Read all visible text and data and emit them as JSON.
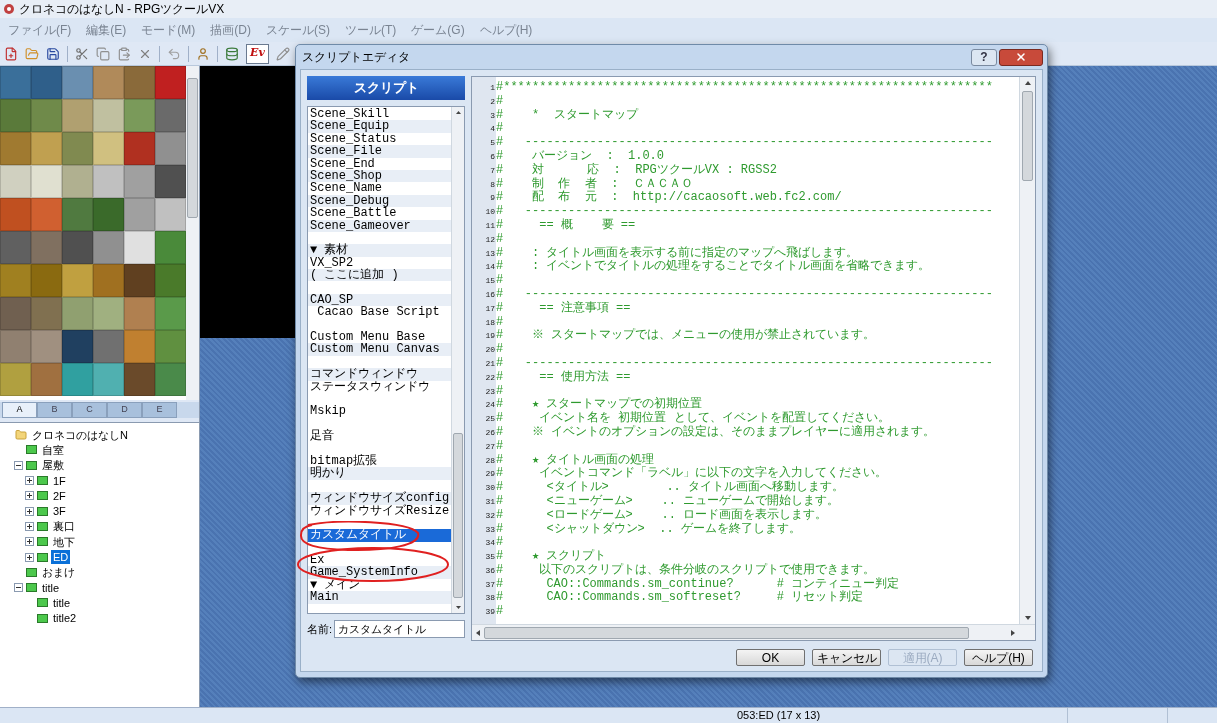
{
  "window": {
    "title": "クロネコのはなしN - RPGツクールVX"
  },
  "menu": [
    "ファイル(F)",
    "編集(E)",
    "モード(M)",
    "描画(D)",
    "スケール(S)",
    "ツール(T)",
    "ゲーム(G)",
    "ヘルプ(H)"
  ],
  "toolbar": {
    "event_button": {
      "label": "Ev",
      "selected": true
    }
  },
  "tileset_tabs": [
    {
      "label": "A",
      "selected": true
    },
    {
      "label": "B",
      "selected": false
    },
    {
      "label": "C",
      "selected": false
    },
    {
      "label": "D",
      "selected": false
    },
    {
      "label": "E",
      "selected": false
    }
  ],
  "map_tree": [
    {
      "kind": "project",
      "label": "クロネコのはなしN",
      "selected": false,
      "children": [
        {
          "kind": "map",
          "label": "自室",
          "selected": false
        },
        {
          "kind": "map",
          "label": "屋敷",
          "selected": false,
          "expanded": true,
          "children": [
            {
              "kind": "map",
              "label": "1F",
              "selected": false,
              "expanded": false
            },
            {
              "kind": "map",
              "label": "2F",
              "selected": false,
              "expanded": false
            },
            {
              "kind": "map",
              "label": "3F",
              "selected": false,
              "expanded": false
            },
            {
              "kind": "map",
              "label": "裏口",
              "selected": false,
              "expanded": false
            },
            {
              "kind": "map",
              "label": "地下",
              "selected": false,
              "expanded": false
            },
            {
              "kind": "map",
              "label": "ED",
              "selected": true,
              "expanded": false
            }
          ]
        },
        {
          "kind": "map",
          "label": "おまけ",
          "selected": false
        },
        {
          "kind": "map",
          "label": "title",
          "selected": false,
          "expanded": true,
          "children": [
            {
              "kind": "map",
              "label": "title",
              "selected": false
            },
            {
              "kind": "map",
              "label": "title2",
              "selected": false
            }
          ]
        }
      ]
    }
  ],
  "dialog": {
    "title": "スクリプトエディタ",
    "help": "?",
    "list_header": "スクリプト",
    "scripts": [
      {
        "kind": "script",
        "text": "Scene_Skill",
        "selected": false
      },
      {
        "kind": "script",
        "text": "Scene_Equip",
        "selected": false
      },
      {
        "kind": "script",
        "text": "Scene_Status",
        "selected": false
      },
      {
        "kind": "script",
        "text": "Scene_File",
        "selected": false
      },
      {
        "kind": "script",
        "text": "Scene_End",
        "selected": false
      },
      {
        "kind": "script",
        "text": "Scene_Shop",
        "selected": false
      },
      {
        "kind": "script",
        "text": "Scene_Name",
        "selected": false
      },
      {
        "kind": "script",
        "text": "Scene_Debug",
        "selected": false
      },
      {
        "kind": "script",
        "text": "Scene_Battle",
        "selected": false
      },
      {
        "kind": "script",
        "text": "Scene_Gameover",
        "selected": false
      },
      {
        "kind": "blank",
        "selected": false
      },
      {
        "kind": "script",
        "text": "▼ 素材",
        "selected": false
      },
      {
        "kind": "script",
        "text": "VX_SP2",
        "selected": false
      },
      {
        "kind": "script",
        "text": "( ここに追加 )",
        "selected": false
      },
      {
        "kind": "blank",
        "selected": false
      },
      {
        "kind": "script",
        "text": "CAO_SP",
        "selected": false
      },
      {
        "kind": "script",
        "text": " Cacao Base Script",
        "selected": false
      },
      {
        "kind": "blank",
        "selected": false
      },
      {
        "kind": "script",
        "text": "Custom Menu Base",
        "selected": false
      },
      {
        "kind": "script",
        "text": "Custom Menu Canvas",
        "selected": false
      },
      {
        "kind": "blank",
        "selected": false
      },
      {
        "kind": "script",
        "text": "コマンドウィンドウ",
        "selected": false
      },
      {
        "kind": "script",
        "text": "ステータスウィンドウ",
        "selected": false
      },
      {
        "kind": "blank",
        "selected": false
      },
      {
        "kind": "script",
        "text": "Mskip",
        "selected": false
      },
      {
        "kind": "blank",
        "selected": false
      },
      {
        "kind": "script",
        "text": "足音",
        "selected": false
      },
      {
        "kind": "blank",
        "selected": false
      },
      {
        "kind": "script",
        "text": "bitmap拡張",
        "selected": false
      },
      {
        "kind": "script",
        "text": "明かり",
        "selected": false
      },
      {
        "kind": "blank",
        "selected": false
      },
      {
        "kind": "script",
        "text": "ウィンドウサイズconfig",
        "selected": false
      },
      {
        "kind": "script",
        "text": "ウィンドウサイズResize",
        "selected": false
      },
      {
        "kind": "blank",
        "selected": false
      },
      {
        "kind": "script",
        "text": "カスタムタイトル",
        "selected": true
      },
      {
        "kind": "blank",
        "selected": false
      },
      {
        "kind": "script",
        "text": "Ex",
        "selected": false
      },
      {
        "kind": "script",
        "text": "Game_SystemInfo",
        "selected": false
      },
      {
        "kind": "script",
        "text": "▼ メイン",
        "selected": false
      },
      {
        "kind": "script",
        "text": "Main",
        "selected": false
      }
    ],
    "name_label": "名前:",
    "name_value": "カスタムタイトル",
    "code_lines": [
      {
        "number": "1",
        "text": "#********************************************************************"
      },
      {
        "number": "2",
        "text": "#"
      },
      {
        "number": "3",
        "text": "#    *  スタートマップ"
      },
      {
        "number": "4",
        "text": "#"
      },
      {
        "number": "5",
        "text": "#   -----------------------------------------------------------------"
      },
      {
        "number": "6",
        "text": "#    バージョン  :  1.0.0"
      },
      {
        "number": "7",
        "text": "#    対      応  :  RPGツクールVX : RGSS2"
      },
      {
        "number": "8",
        "text": "#    制  作  者  :  ＣＡＣＡＯ"
      },
      {
        "number": "9",
        "text": "#    配  布  元  :  http://cacaosoft.web.fc2.com/"
      },
      {
        "number": "10",
        "text": "#   -----------------------------------------------------------------"
      },
      {
        "number": "11",
        "text": "#     == 概    要 =="
      },
      {
        "number": "12",
        "text": "#"
      },
      {
        "number": "13",
        "text": "#    : タイトル画面を表示する前に指定のマップへ飛ばします。"
      },
      {
        "number": "14",
        "text": "#    : イベントでタイトルの処理をすることでタイトル画面を省略できます。"
      },
      {
        "number": "15",
        "text": "#"
      },
      {
        "number": "16",
        "text": "#   -----------------------------------------------------------------"
      },
      {
        "number": "17",
        "text": "#     == 注意事項 =="
      },
      {
        "number": "18",
        "text": "#"
      },
      {
        "number": "19",
        "text": "#    ※ スタートマップでは、メニューの使用が禁止されています。"
      },
      {
        "number": "20",
        "text": "#"
      },
      {
        "number": "21",
        "text": "#   -----------------------------------------------------------------"
      },
      {
        "number": "22",
        "text": "#     == 使用方法 =="
      },
      {
        "number": "23",
        "text": "#"
      },
      {
        "number": "24",
        "text": "#    ★ スタートマップでの初期位置"
      },
      {
        "number": "25",
        "text": "#     イベント名を 初期位置 として、イベントを配置してください。"
      },
      {
        "number": "26",
        "text": "#    ※ イベントのオプションの設定は、そのままプレイヤーに適用されます。"
      },
      {
        "number": "27",
        "text": "#"
      },
      {
        "number": "28",
        "text": "#    ★ タイトル画面の処理"
      },
      {
        "number": "29",
        "text": "#     イベントコマンド「ラベル」に以下の文字を入力してください。"
      },
      {
        "number": "30",
        "text": "#      <タイトル>        .. タイトル画面へ移動します。"
      },
      {
        "number": "31",
        "text": "#      <ニューゲーム>    .. ニューゲームで開始します。"
      },
      {
        "number": "32",
        "text": "#      <ロードゲーム>    .. ロード画面を表示します。"
      },
      {
        "number": "33",
        "text": "#      <シャットダウン>  .. ゲームを終了します。"
      },
      {
        "number": "34",
        "text": "#"
      },
      {
        "number": "35",
        "text": "#    ★ スクリプト"
      },
      {
        "number": "36",
        "text": "#     以下のスクリプトは、条件分岐のスクリプトで使用できます。"
      },
      {
        "number": "37",
        "text": "#      CAO::Commands.sm_continue?      # コンティニュー判定"
      },
      {
        "number": "38",
        "text": "#      CAO::Commands.sm_softreset?     # リセット判定"
      },
      {
        "number": "39",
        "text": "#"
      }
    ],
    "buttons": [
      {
        "label": "OK",
        "disabled": false
      },
      {
        "label": "キャンセル",
        "disabled": false
      },
      {
        "label": "適用(A)",
        "disabled": true
      },
      {
        "label": "ヘルプ(H)",
        "disabled": false
      }
    ]
  },
  "status_bar": {
    "text": "053:ED (17 x 13)"
  }
}
